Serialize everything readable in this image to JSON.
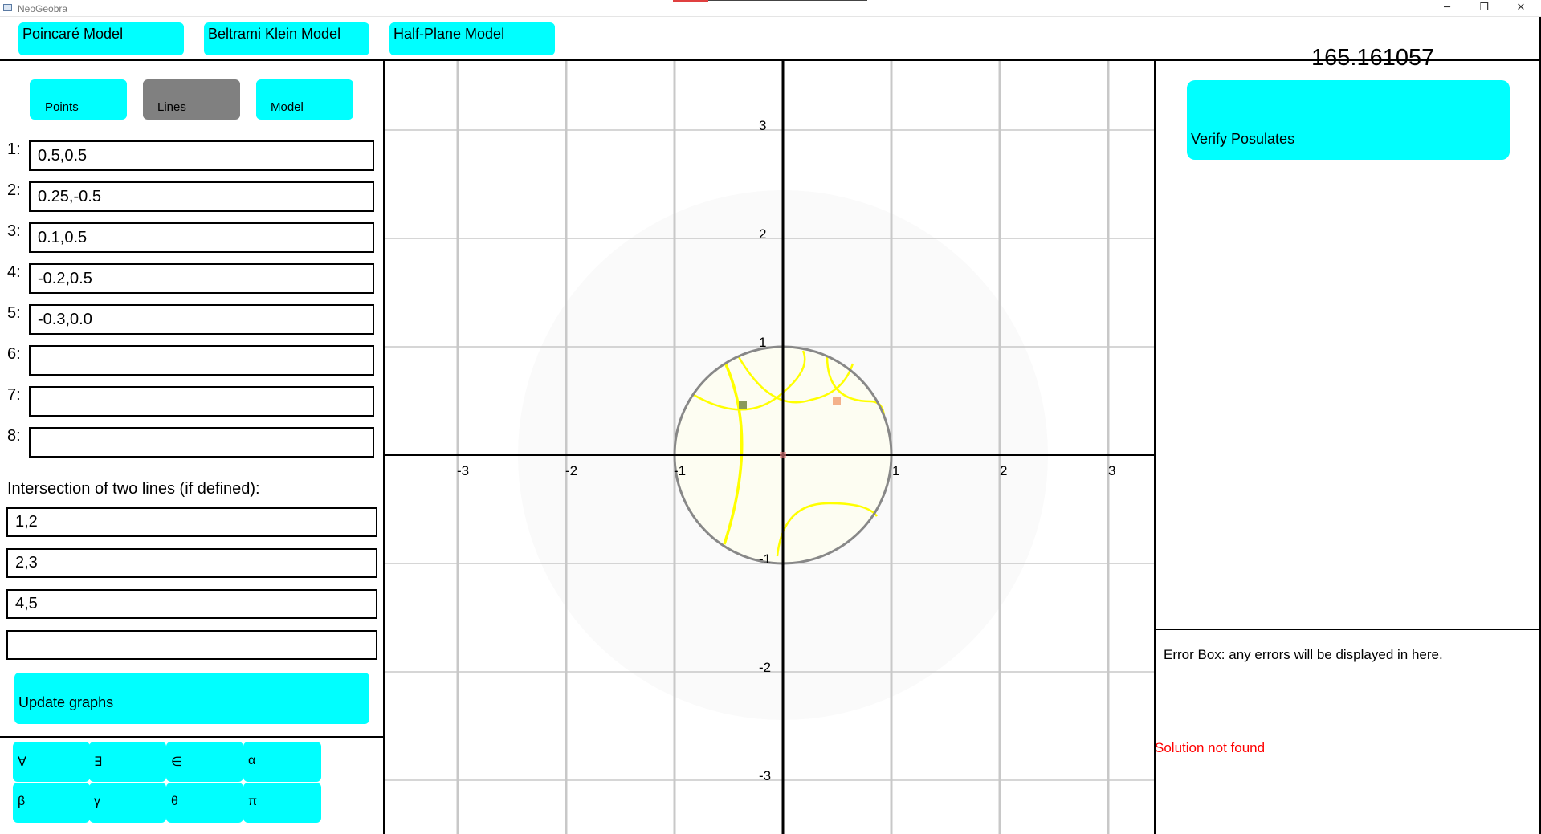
{
  "window": {
    "title": "NeoGeobra",
    "minimize_icon": "minimize-icon",
    "restore_icon": "restore-icon",
    "close_icon": "close-icon"
  },
  "models": {
    "poincare": "Poincaré Model",
    "klein": "Beltrami Klein Model",
    "half_plane": "Half-Plane Model"
  },
  "score": "165.161057",
  "tabs": {
    "points": "Points",
    "lines": "Lines",
    "model": "Model",
    "selected": "Lines"
  },
  "lines": [
    {
      "label": "1:",
      "value": "0.5,0.5"
    },
    {
      "label": "2:",
      "value": "0.25,-0.5"
    },
    {
      "label": "3:",
      "value": "0.1,0.5"
    },
    {
      "label": "4:",
      "value": "-0.2,0.5"
    },
    {
      "label": "5:",
      "value": "-0.3,0.0"
    },
    {
      "label": "6:",
      "value": ""
    },
    {
      "label": "7:",
      "value": ""
    },
    {
      "label": "8:",
      "value": ""
    }
  ],
  "intersection": {
    "heading": "Intersection of two lines (if defined):",
    "fields": [
      "1,2",
      "2,3",
      "4,5",
      ""
    ]
  },
  "update_button": "Update graphs",
  "symbols": {
    "row1": [
      "∀",
      "∃",
      "∈",
      "α"
    ],
    "row2": [
      "β",
      "γ",
      "θ",
      "π"
    ]
  },
  "graph": {
    "x_ticks": [
      "-3",
      "-2",
      "-1",
      "1",
      "2",
      "3"
    ],
    "y_ticks": [
      "3",
      "2",
      "1",
      "-1",
      "-2",
      "-3"
    ],
    "colors": {
      "disk_fill": "#fdfdf2",
      "disk_border": "#888888",
      "geodesic": "#ffff00",
      "grid": "#c8c8c8",
      "axis": "#000000"
    }
  },
  "verify_button": "Verify Posulates",
  "error_box": {
    "label": "Error Box: any errors will be displayed in here.",
    "message": "Solution not found",
    "message_color": "#ff0000"
  }
}
